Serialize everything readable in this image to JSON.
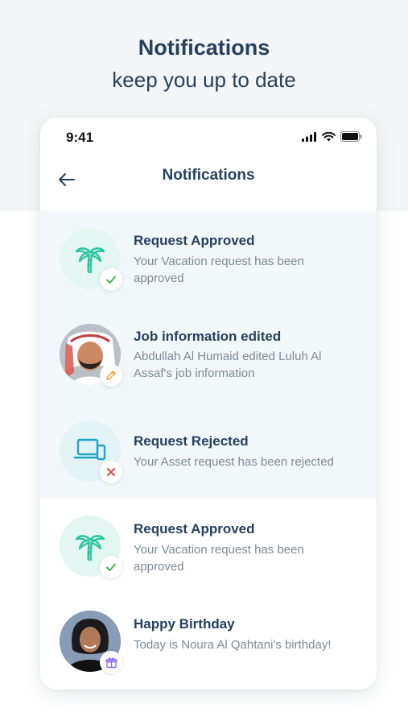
{
  "promo": {
    "title": "Notifications",
    "subtitle": "keep you up to date"
  },
  "status_bar": {
    "time": "9:41",
    "icons": [
      "cellular-signal-icon",
      "wifi-icon",
      "battery-icon"
    ]
  },
  "nav": {
    "back_icon": "arrow-left-icon",
    "title": "Notifications"
  },
  "colors": {
    "title_text": "#26405d",
    "body_text": "#7d8a98",
    "unread_bg": "#f2f8f9",
    "accent_mint": "#2ec4a0",
    "accent_blue": "#1fa3c9",
    "approved_green": "#4caf50",
    "rejected_red": "#e0454a",
    "edit_orange": "#f0a040",
    "gift_purple": "#8a6cf0"
  },
  "notifications": [
    {
      "title": "Request Approved",
      "body": "Your Vacation request has been approved",
      "icon": "palm-tree-icon",
      "badge": "check-icon",
      "unread": true
    },
    {
      "title": "Job information edited",
      "body": "Abdullah Al Humaid edited Luluh Al Assaf's job information",
      "icon": "avatar-photo",
      "badge": "pencil-icon",
      "unread": true
    },
    {
      "title": "Request Rejected",
      "body": "Your Asset request has been rejected",
      "icon": "laptop-icon",
      "badge": "close-icon",
      "unread": true
    },
    {
      "title": "Request Approved",
      "body": "Your Vacation request has been approved",
      "icon": "palm-tree-icon",
      "badge": "check-icon",
      "unread": false
    },
    {
      "title": "Happy Birthday",
      "body": "Today is Noura Al Qahtani's birthday!",
      "icon": "avatar-photo",
      "badge": "gift-icon",
      "unread": false
    }
  ]
}
